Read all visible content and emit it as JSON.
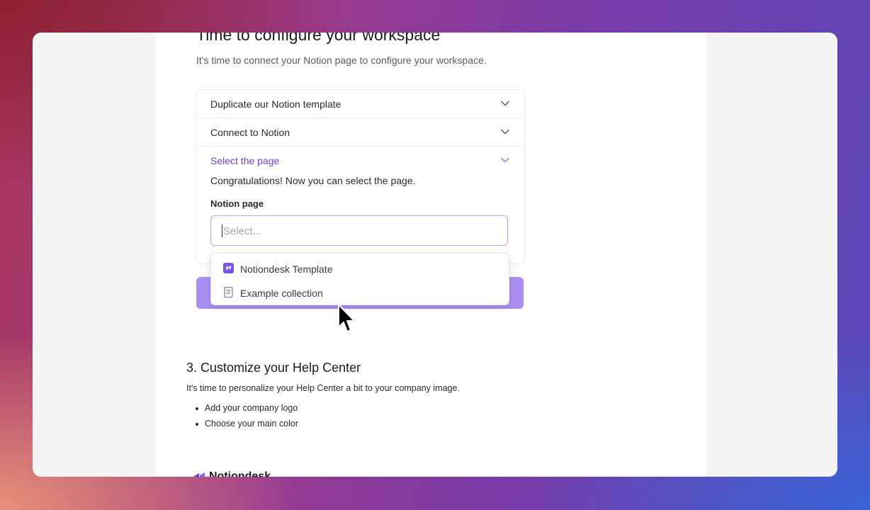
{
  "page": {
    "title": "Time to configure your workspace",
    "subtitle": "It's time to connect your Notion page to configure your workspace."
  },
  "accordion": {
    "items": [
      {
        "label": "Duplicate our Notion template"
      },
      {
        "label": "Connect to Notion"
      },
      {
        "label": "Select the page"
      }
    ],
    "open_content": {
      "message": "Congratulations! Now you can select the page.",
      "field_label": "Notion page",
      "select_placeholder": "Select..."
    }
  },
  "dropdown": {
    "options": [
      {
        "label": "Notiondesk Template",
        "icon": "notiondesk-logo-icon"
      },
      {
        "label": "Example collection",
        "icon": "document-icon"
      }
    ]
  },
  "section": {
    "heading": "3. Customize your Help Center",
    "text": "It's time to personalize your Help Center a bit to your company image.",
    "bullets": [
      "Add your company logo",
      "Choose your main color"
    ]
  },
  "brand": {
    "name": "Notiondesk"
  },
  "colors": {
    "accent": "#6a44e0",
    "button": "#a98ff4",
    "input_border": "#b3a6f2"
  }
}
